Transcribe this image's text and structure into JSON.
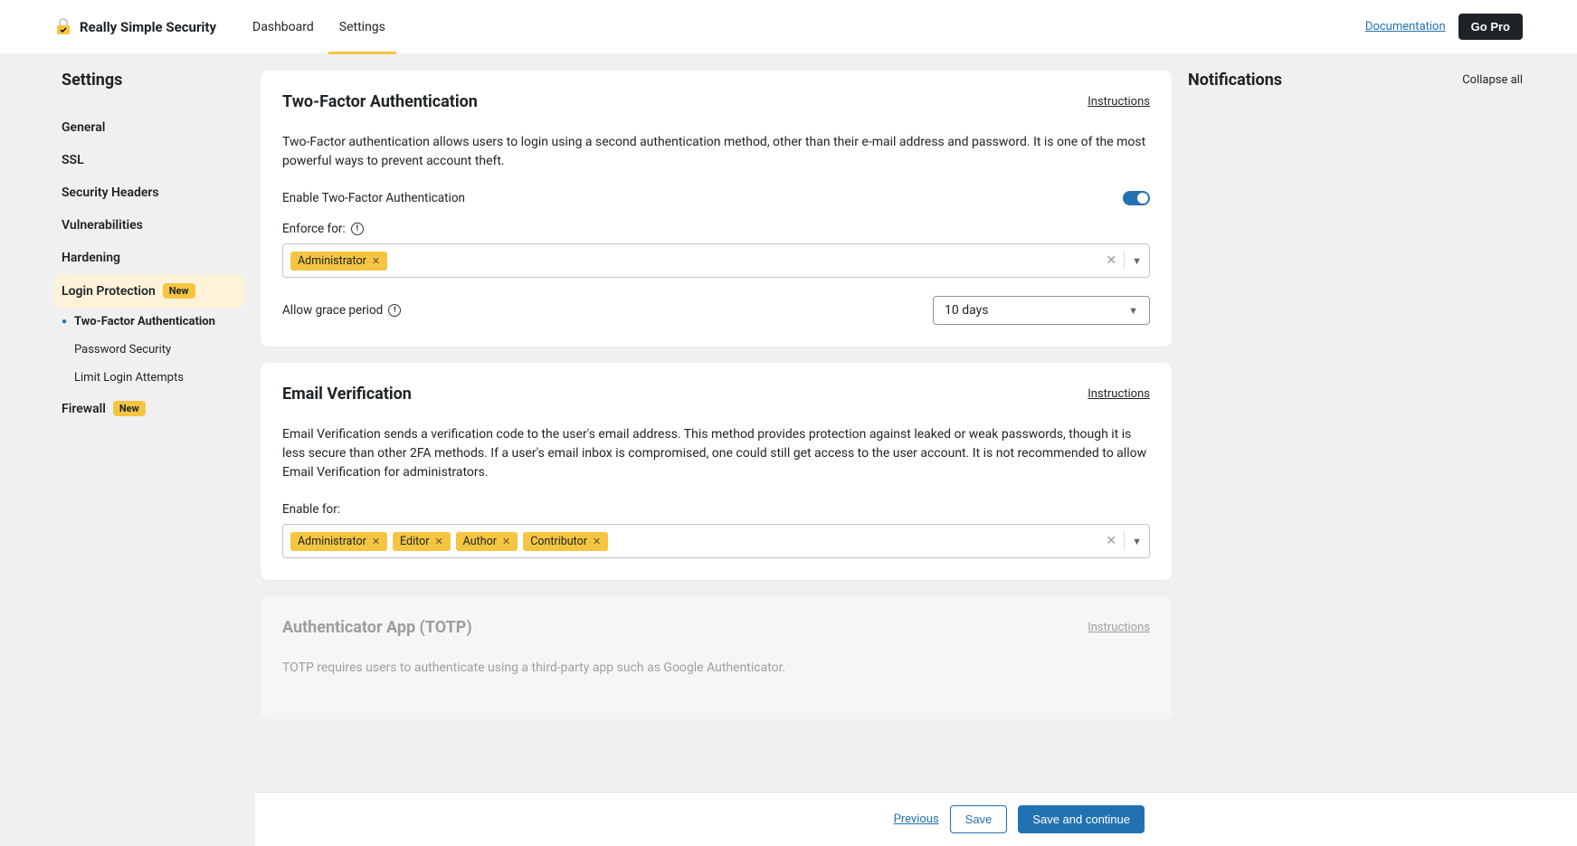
{
  "brand": "Really Simple Security",
  "tabs": {
    "dashboard": "Dashboard",
    "settings": "Settings"
  },
  "header": {
    "doc": "Documentation",
    "pro": "Go Pro"
  },
  "sidebar": {
    "title": "Settings",
    "items": {
      "general": "General",
      "ssl": "SSL",
      "headers": "Security Headers",
      "vuln": "Vulnerabilities",
      "hardening": "Hardening",
      "login": "Login Protection",
      "firewall": "Firewall"
    },
    "sub": {
      "tfa": "Two-Factor Authentication",
      "passwd": "Password Security",
      "limit": "Limit Login Attempts"
    },
    "badge": "New"
  },
  "tfa": {
    "title": "Two-Factor Authentication",
    "instructions": "Instructions",
    "desc": "Two-Factor authentication allows users to login using a second authentication method, other than their e-mail address and password. It is one of the most powerful ways to prevent account theft.",
    "enable_label": "Enable Two-Factor Authentication",
    "enforce_label": "Enforce for:",
    "enforce_tags": [
      "Administrator"
    ],
    "grace_label": "Allow grace period",
    "grace_value": "10 days"
  },
  "email": {
    "title": "Email Verification",
    "instructions": "Instructions",
    "desc": "Email Verification sends a verification code to the user's email address. This method provides protection against leaked or weak passwords, though it is less secure than other 2FA methods. If a user's email inbox is compromised, one could still get access to the user account. It is not recommended to allow Email Verification for administrators.",
    "enable_label": "Enable for:",
    "tags": [
      "Administrator",
      "Editor",
      "Author",
      "Contributor"
    ]
  },
  "totp": {
    "title": "Authenticator App (TOTP)",
    "instructions": "Instructions",
    "desc": "TOTP requires users to authenticate using a third-party app such as Google Authenticator."
  },
  "right": {
    "title": "Notifications",
    "collapse": "Collapse all"
  },
  "footer": {
    "prev": "Previous",
    "save": "Save",
    "continue": "Save and continue"
  }
}
